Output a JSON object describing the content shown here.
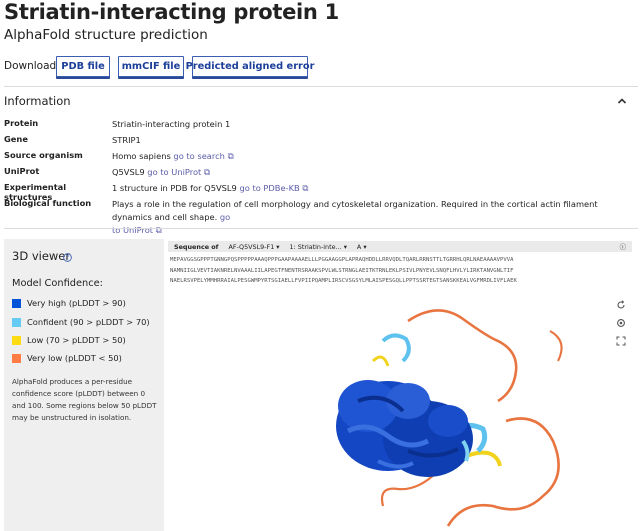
{
  "header": {
    "title": "Striatin-interacting protein 1",
    "subtitle": "AlphaFold structure prediction"
  },
  "download": {
    "label": "Download",
    "buttons": [
      "PDB file",
      "mmCIF file",
      "Predicted aligned error"
    ]
  },
  "information": {
    "heading": "Information",
    "rows": {
      "protein": {
        "key": "Protein",
        "value": "Striatin-interacting protein 1"
      },
      "gene": {
        "key": "Gene",
        "value": "STRIP1"
      },
      "organism": {
        "key": "Source organism",
        "value": "Homo sapiens",
        "link": "go to search"
      },
      "uniprot": {
        "key": "UniProt",
        "value": "Q5VSL9",
        "link": "go to UniProt"
      },
      "structures": {
        "key": "Experimental structures",
        "value": "1 structure in PDB for Q5VSL9",
        "link": "go to PDBe-KB"
      },
      "function": {
        "key": "Biological function",
        "value": "Plays a role in the regulation of cell morphology and cytoskeletal organization. Required in the cortical actin filament dynamics and cell shape.",
        "link_a": "go",
        "link_b": "to UniProt"
      }
    }
  },
  "viewer": {
    "title": "3D viewer",
    "confidence_title": "Model Confidence:",
    "legend": [
      {
        "label": "Very high (pLDDT > 90)",
        "color": "#0053d6"
      },
      {
        "label": "Confident (90 > pLDDT > 70)",
        "color": "#65cbf3"
      },
      {
        "label": "Low (70 > pLDDT > 50)",
        "color": "#ffdb13"
      },
      {
        "label": "Very low (pLDDT < 50)",
        "color": "#ff7d45"
      }
    ],
    "note": "AlphaFold produces a per-residue confidence score (pLDDT) between 0 and 100. Some regions below 50 pLDDT may be unstructured in isolation.",
    "sequence_bar": {
      "label": "Sequence of",
      "entity": "AF-Q5VSL9-F1",
      "chain": "1: Striatin-inte...",
      "residue": "A"
    },
    "sequence_lines": [
      "MEPAVGGSGPPPTGNNGPQSPPPPPAAAQPPPGAAPAAAAELLLPGGAAGGPLAPRAQHDDLLRRVQDLTQARLRRNSTTLTGRRHLQRLNAEAAAAVPVVA",
      "NAMNIIGLVEVTIAKNRELNVAAALIILAPEGTFNENTRSRAAKSPVLWLSTRNGLAEITKTRNLEKLPSIVLPNYEVLSNQFLHVLYLIRKTANVGNLTIF",
      "NAELRSVPELYMMHRRAIALPESGWMPYRTSGIAELLFVPIIPQAMPLIRSCVSGSYLMLAISPESGQLLPPTSSRTEGTSANSKKEALVGFMRDLIVFLAEK"
    ],
    "viewer_buttons": [
      "reset-icon",
      "settings-icon",
      "expand-icon"
    ]
  }
}
